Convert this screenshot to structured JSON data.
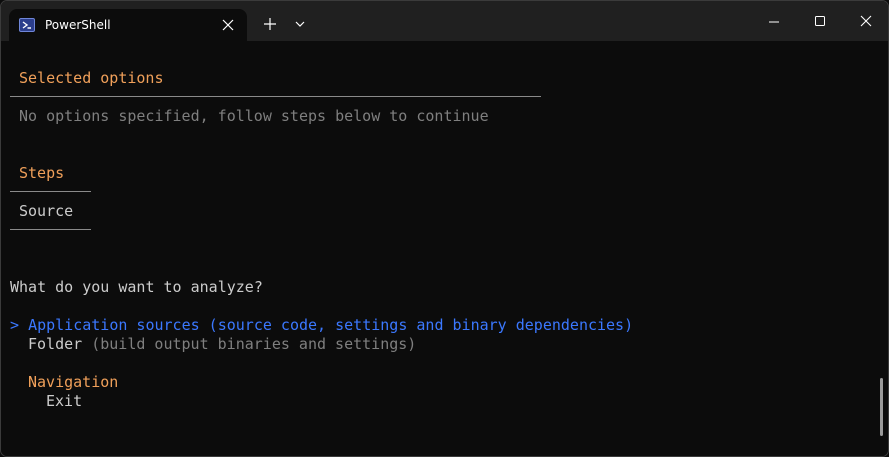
{
  "window": {
    "tab_title": "PowerShell",
    "tab_icon": "powershell-icon"
  },
  "terminal": {
    "selected_heading": "Selected options",
    "selected_body": "No options specified, follow steps below to continue",
    "steps_heading": "Steps",
    "step_current": "Source",
    "question": "What do you want to analyze?",
    "option_selected_prefix": "> ",
    "option_selected": "Application sources (source code, settings and binary dependencies)",
    "option2_name": "Folder",
    "option2_desc": " (build output binaries and settings)",
    "navigation_heading": "Navigation",
    "navigation_exit": "Exit"
  },
  "colors": {
    "accent_orange": "#f0a05a",
    "selection_blue": "#3b78ff",
    "text": "#cccccc",
    "dim": "#7f7f7f",
    "background": "#0c0c0c"
  }
}
